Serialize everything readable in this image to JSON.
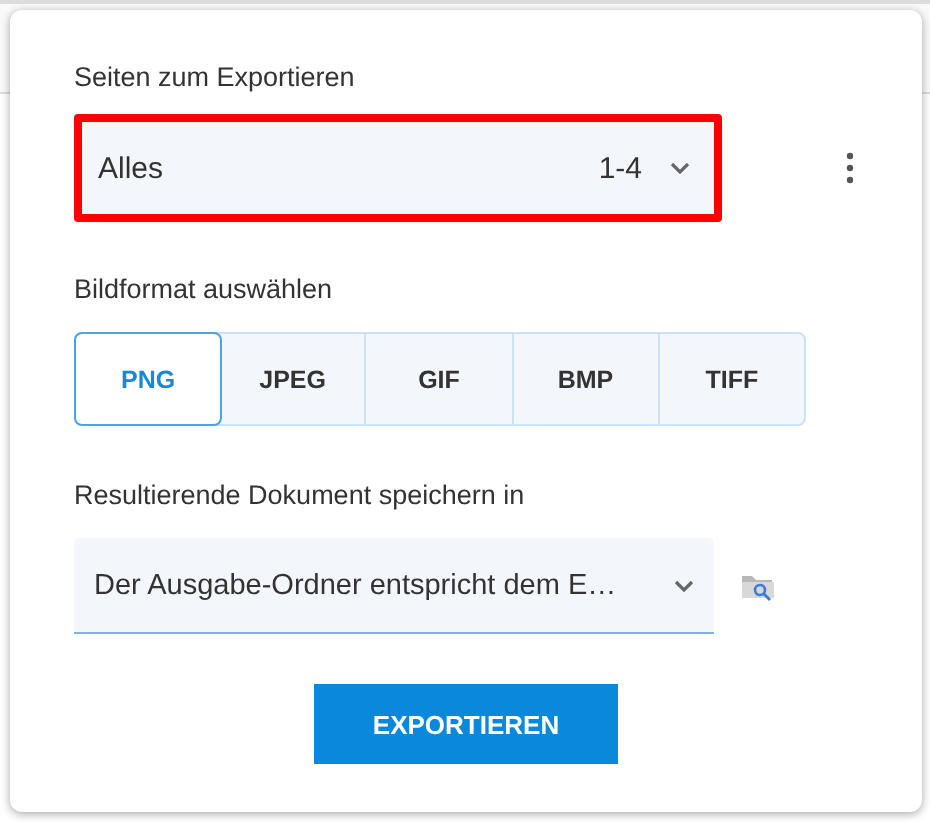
{
  "pages": {
    "label": "Seiten zum Exportieren",
    "value": "Alles",
    "range": "1-4",
    "highlighted": true
  },
  "format": {
    "label": "Bildformat auswählen",
    "options": [
      {
        "label": "PNG",
        "selected": true
      },
      {
        "label": "JPEG",
        "selected": false
      },
      {
        "label": "GIF",
        "selected": false
      },
      {
        "label": "BMP",
        "selected": false
      },
      {
        "label": "TIFF",
        "selected": false
      }
    ]
  },
  "destination": {
    "label": "Resultierende Dokument speichern in",
    "value": "Der Ausgabe-Ordner entspricht dem E…"
  },
  "export_button": "EXPORTIEREN"
}
